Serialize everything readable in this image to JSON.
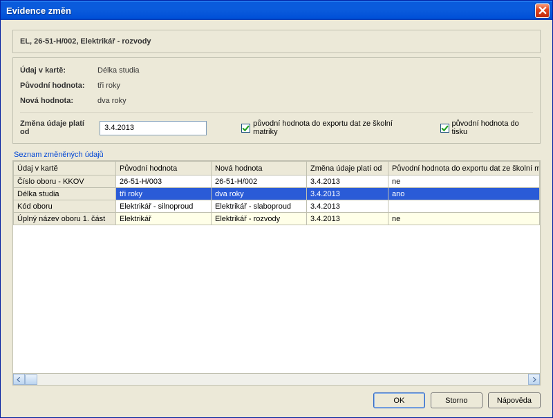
{
  "window": {
    "title": "Evidence změn"
  },
  "header": {
    "text": "EL, 26-51-H/002, Elektrikář - rozvody"
  },
  "info": {
    "field_label": "Údaj v kartě:",
    "field_value": "Délka studia",
    "old_label": "Původní hodnota:",
    "old_value": "tři roky",
    "new_label": "Nová hodnota:",
    "new_value": "dva roky"
  },
  "date": {
    "label": "Změna údaje platí od",
    "value": "3.4.2013",
    "chk_export": "původní hodnota do exportu dat ze školní matriky",
    "chk_print": "původní hodnota do tisku"
  },
  "list": {
    "title": "Seznam změněných údajů",
    "columns": {
      "c0": "Údaj v kartě",
      "c1": "Původní hodnota",
      "c2": "Nová hodnota",
      "c3": "Změna údaje platí od",
      "c4": "Původní hodnota do exportu dat ze školní matriky"
    },
    "rows": [
      {
        "c0": "Číslo oboru - KKOV",
        "c1": "26-51-H/003",
        "c2": "26-51-H/002",
        "c3": "3.4.2013",
        "c4": "ne"
      },
      {
        "c0": "Délka studia",
        "c1": "tři roky",
        "c2": "dva roky",
        "c3": "3.4.2013",
        "c4": "ano"
      },
      {
        "c0": "Kód oboru",
        "c1": "Elektrikář - silnoproud",
        "c2": "Elektrikář - slaboproud",
        "c3": "3.4.2013",
        "c4": ""
      },
      {
        "c0": "Úplný název oboru 1. část",
        "c1": "Elektrikář",
        "c2": "Elektrikář - rozvody",
        "c3": "3.4.2013",
        "c4": "ne"
      }
    ]
  },
  "buttons": {
    "ok": "OK",
    "cancel": "Storno",
    "help": "Nápověda"
  }
}
